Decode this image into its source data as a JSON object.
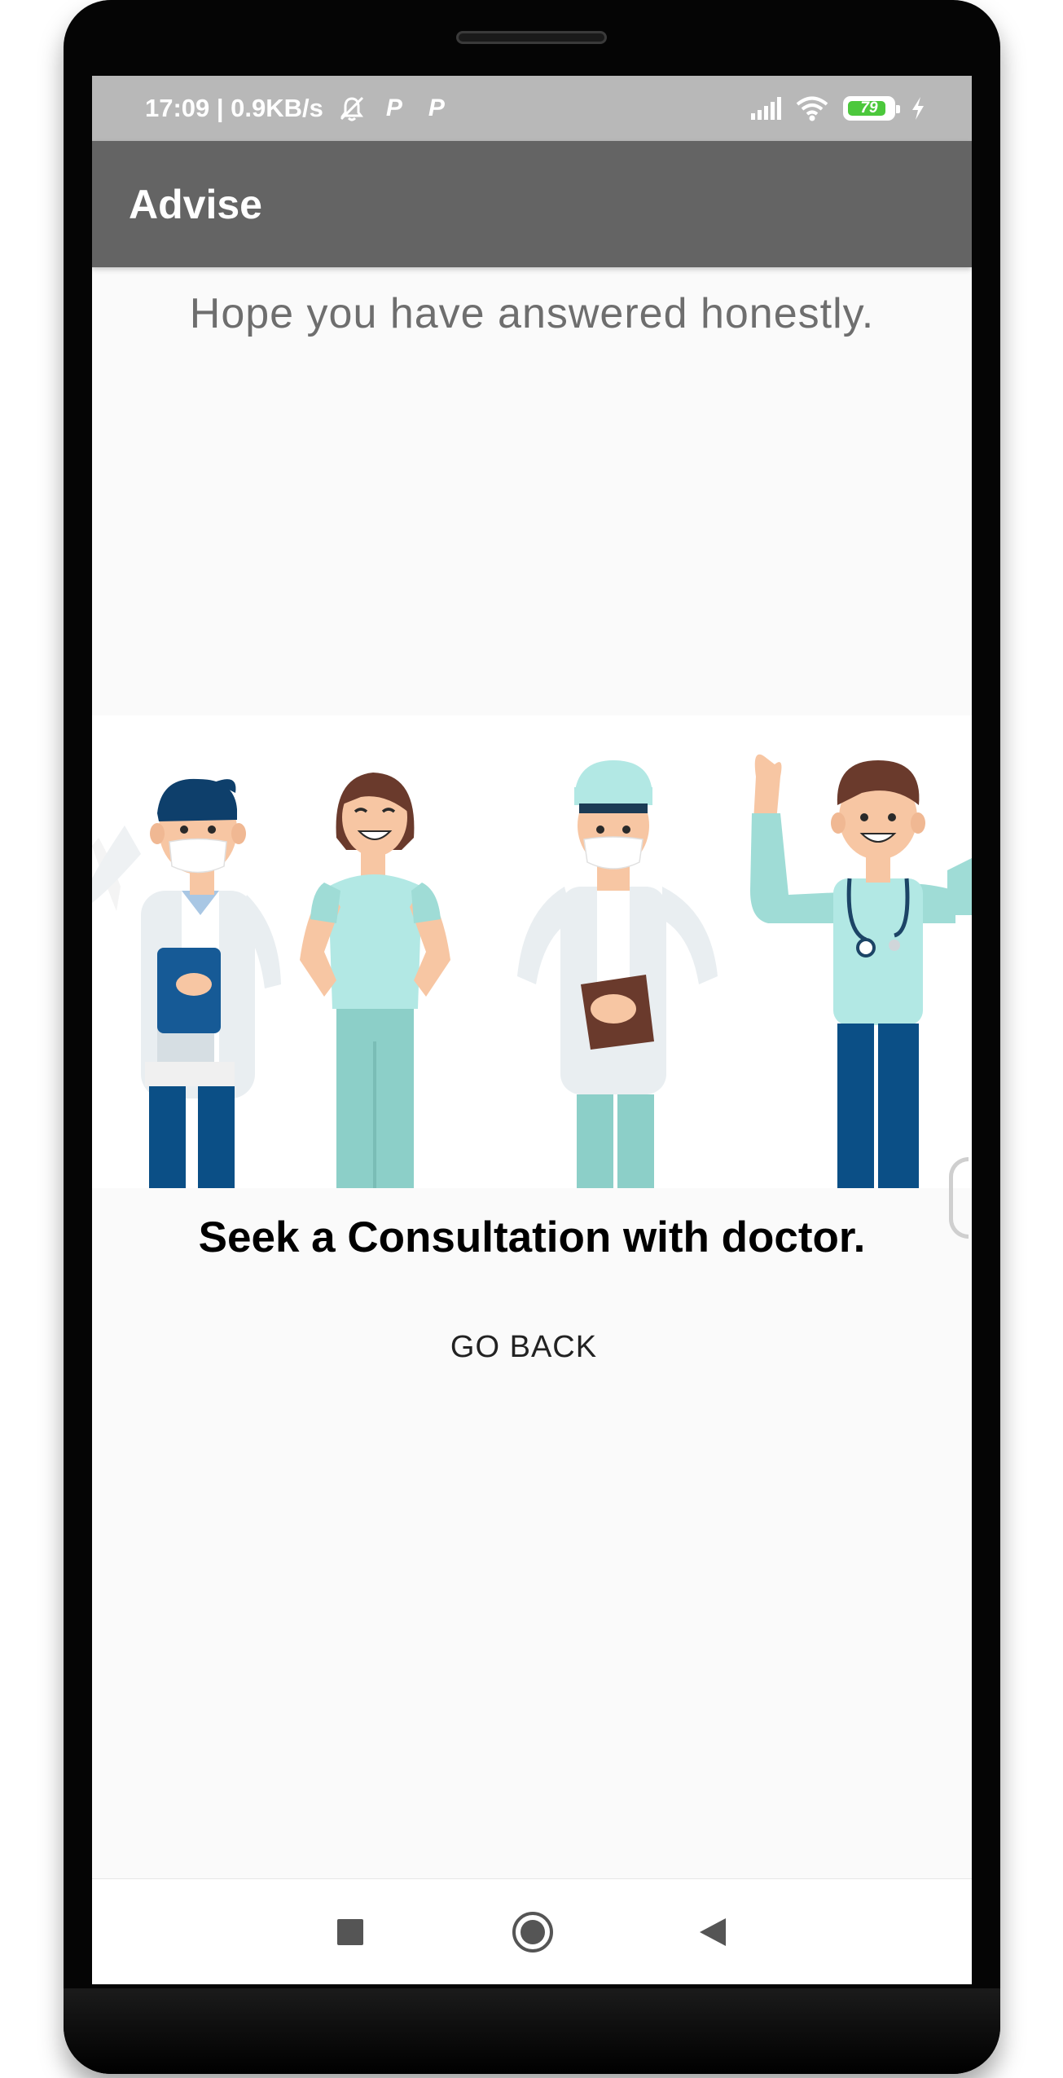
{
  "status_bar": {
    "time_speed": "17:09 | 0.9KB/s",
    "battery_level": "79",
    "icons": [
      "bell-muted-icon",
      "parking-icon",
      "parking-icon",
      "signal-icon",
      "wifi-icon",
      "battery-icon",
      "charging-bolt-icon"
    ]
  },
  "app_bar": {
    "title": "Advise"
  },
  "main": {
    "hope_text": "Hope you have answered honestly.",
    "illustration": "medical-staff-illustration",
    "consult_text": "Seek a Consultation with doctor.",
    "go_back_label": "GO BACK"
  },
  "nav_bar": {
    "buttons": [
      "recents-square-icon",
      "home-circle-icon",
      "back-triangle-icon"
    ]
  },
  "colors": {
    "status_bar": "#b8b8b8",
    "app_bar": "#646464",
    "background": "#fafafa",
    "battery_green": "#4cc83c",
    "scrubs_teal": "#b2e8e4",
    "pants_navy": "#0b5288"
  }
}
